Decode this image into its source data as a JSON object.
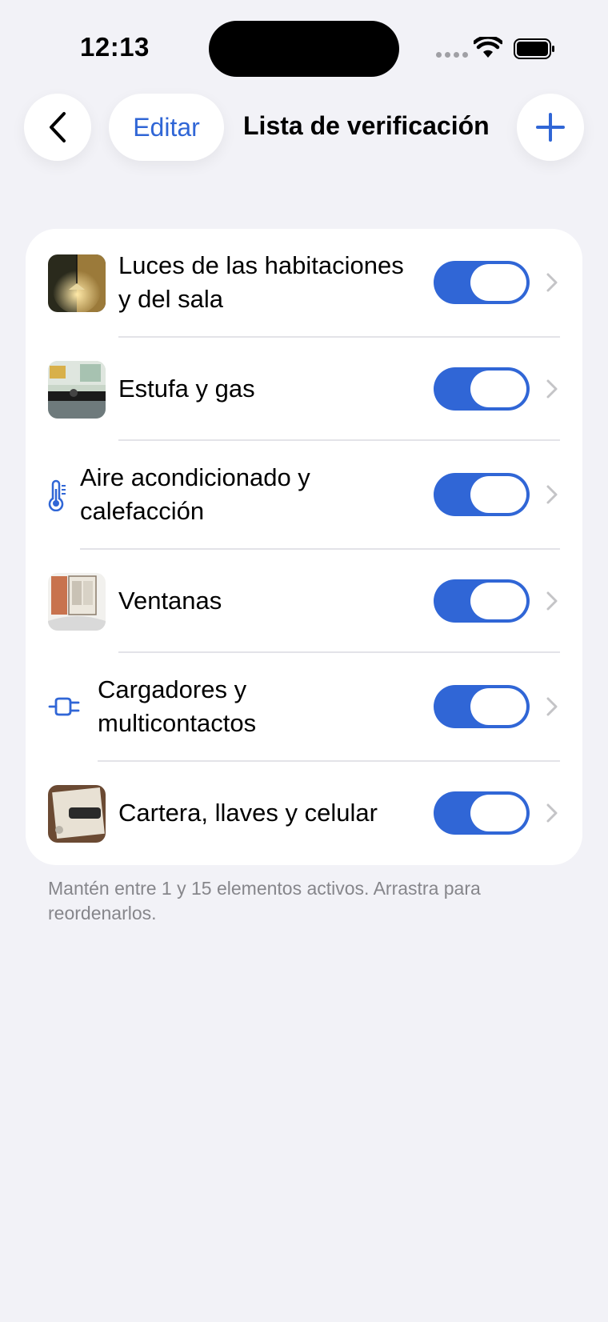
{
  "status_bar": {
    "time": "12:13"
  },
  "nav": {
    "edit_label": "Editar",
    "title": "Lista de verificación"
  },
  "checklist": {
    "items": [
      {
        "label": "Luces de las habitaciones y del sala",
        "enabled": true,
        "icon": "lamp-photo"
      },
      {
        "label": "Estufa y gas",
        "enabled": true,
        "icon": "kitchen-photo"
      },
      {
        "label": "Aire acondicionado y calefacción",
        "enabled": true,
        "icon": "thermometer-icon"
      },
      {
        "label": "Ventanas",
        "enabled": true,
        "icon": "window-photo"
      },
      {
        "label": "Cargadores y multicontactos",
        "enabled": true,
        "icon": "plug-icon"
      },
      {
        "label": "Cartera, llaves y celular",
        "enabled": true,
        "icon": "wallet-photo"
      }
    ]
  },
  "footnote": "Mantén entre 1 y 15 elementos activos. Arrastra para reordenarlos.",
  "colors": {
    "accent": "#3066d6",
    "background": "#f2f2f7",
    "card": "#ffffff",
    "secondary_text": "#86868b"
  }
}
